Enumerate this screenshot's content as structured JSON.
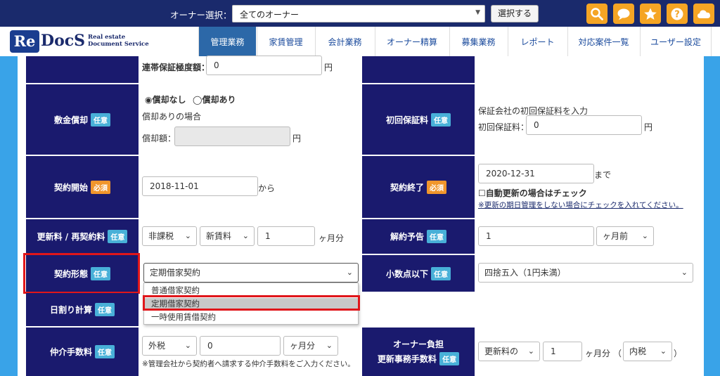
{
  "topbar": {
    "owner_label": "オーナー選択：",
    "owner_value": "全てのオーナー",
    "select_button": "選択する"
  },
  "tools": [
    "search-icon",
    "chat-icon",
    "star-icon",
    "help-icon",
    "cloud-icon"
  ],
  "logo": {
    "badge": "Re",
    "name": "DocS",
    "sub1": "Real estate",
    "sub2": "Document Service"
  },
  "nav": {
    "tabs": [
      "管理業務",
      "家賃管理",
      "会計業務",
      "オーナー精算",
      "募集業務",
      "レポート",
      "対応案件一覧",
      "ユーザー設定"
    ],
    "active": "管理業務"
  },
  "badges": {
    "optional": "任意",
    "required": "必須"
  },
  "form": {
    "guarantee": {
      "label": "連帯保証極度額：",
      "value": "0",
      "unit": "円"
    },
    "deposit": {
      "label": "敷金償却",
      "radio1": "償却なし",
      "radio2": "償却あり",
      "note": "償却ありの場合",
      "amount_label": "償却額：",
      "amount_value": "",
      "unit": "円"
    },
    "initial_fee": {
      "label": "初回保証料",
      "note": "保証会社の初回保証料を入力",
      "field_label": "初回保証料：",
      "value": "0",
      "unit": "円"
    },
    "contract_start": {
      "label": "契約開始",
      "value": "2018-11-01",
      "suffix": "から"
    },
    "contract_end": {
      "label": "契約終了",
      "value": "2020-12-31",
      "suffix": "まで",
      "checkbox_label": "自動更新の場合はチェック",
      "note": "※更新の期日管理をしない場合にチェックを入れてください。"
    },
    "renewal": {
      "label": "更新料 / 再契約料",
      "tax": "非課税",
      "basis": "新賃料",
      "amount": "1",
      "unit": "ヶ月分"
    },
    "cancel_notice": {
      "label": "解約予告",
      "value": "1",
      "unit": "ヶ月前"
    },
    "contract_type": {
      "label": "契約形態",
      "value": "定期借家契約",
      "options": [
        "普通借家契約",
        "定期借家契約",
        "一時使用賃借契約"
      ]
    },
    "decimal": {
      "label": "小数点以下",
      "value": "四捨五入（1円未満）"
    },
    "daily_calc": {
      "label": "日割り計算"
    },
    "brokerage": {
      "label": "仲介手数料",
      "tax": "外税",
      "amount": "0",
      "unit": "ヶ月分",
      "note": "※管理会社から契約者へ請求する仲介手数料をご入力ください。"
    },
    "owner_burden": {
      "label_line1": "オーナー負担",
      "label_line2": "更新事務手数料",
      "basis": "更新料の",
      "amount": "1",
      "unit": "ヶ月分",
      "paren_open": "（",
      "tax": "内税",
      "paren_close": "）"
    }
  },
  "colors": {
    "topbar": "#1a2a6c",
    "label_bg": "#1a1a6e",
    "accent_orange": "#f5a524",
    "badge_optional": "#48b0d8",
    "badge_required": "#f0962c",
    "nav_active": "#2c68a8",
    "highlight": "#e0161a"
  }
}
